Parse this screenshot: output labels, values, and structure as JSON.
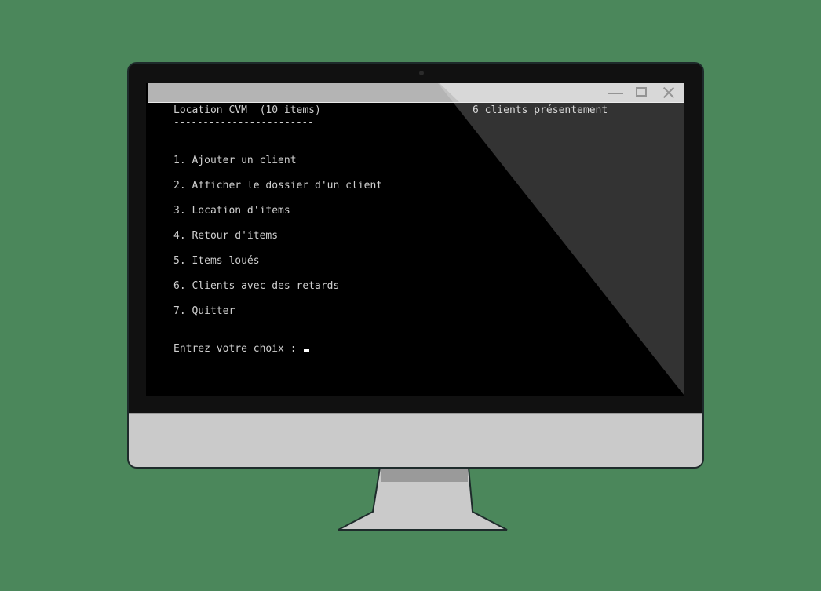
{
  "window": {
    "controls": {
      "minimize_icon": "minimize-icon",
      "maximize_icon": "maximize-icon",
      "close_icon": "close-icon"
    }
  },
  "console": {
    "title": "Location CVM  (10 items)",
    "rule": "------------------------",
    "status": "6 clients présentement",
    "menu": [
      {
        "label": "1. Ajouter un client"
      },
      {
        "label": "2. Afficher le dossier d'un client"
      },
      {
        "label": "3. Location d'items"
      },
      {
        "label": "4. Retour d'items"
      },
      {
        "label": "5. Items loués"
      },
      {
        "label": "6. Clients avec des retards"
      },
      {
        "label": "7. Quitter"
      }
    ],
    "prompt": "Entrez votre choix : "
  },
  "colors": {
    "background": "#4b875b",
    "screen": "#000000",
    "text": "#cfcfcf",
    "bezel": "#111111",
    "chin": "#cacaca"
  }
}
